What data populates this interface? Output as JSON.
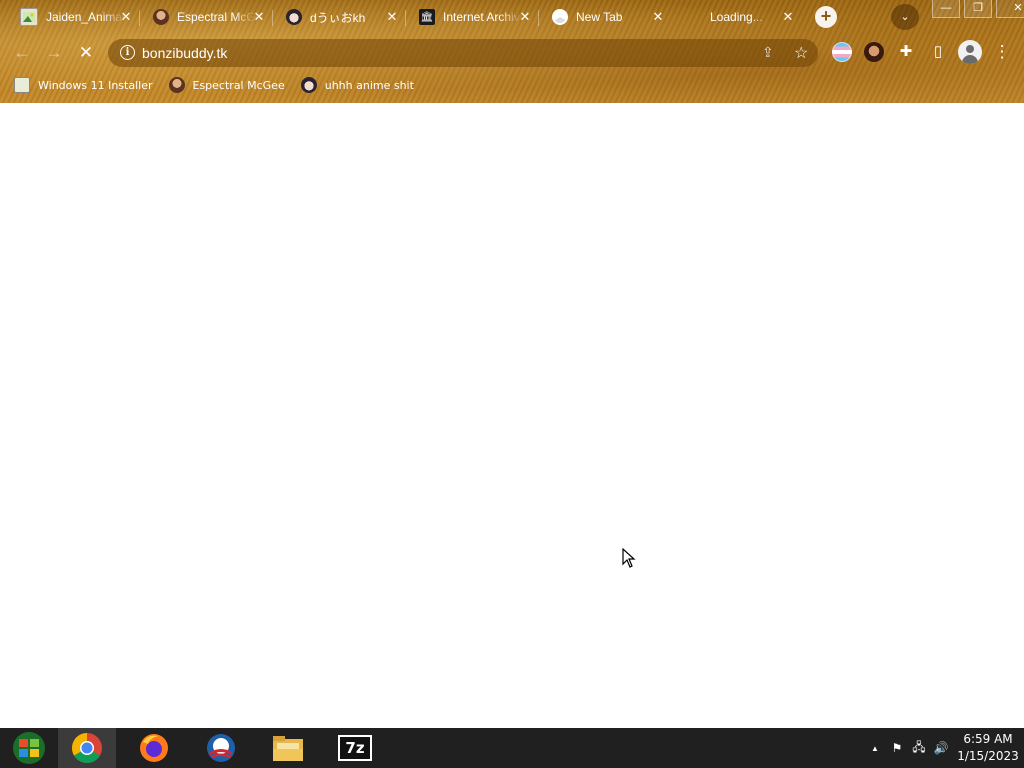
{
  "tabs": [
    {
      "title": "Jaiden_Animations",
      "favicon": "image-icon",
      "close": "✕"
    },
    {
      "title": "Espectral McGee",
      "favicon": "avatar-icon",
      "close": "✕"
    },
    {
      "title": "dうぃおkh",
      "favicon": "anime-avatar-icon",
      "close": "✕"
    },
    {
      "title": "Internet Archive",
      "favicon": "archive-icon",
      "close": "✕"
    },
    {
      "title": "New Tab",
      "favicon": "chrome-icon",
      "close": "✕"
    },
    {
      "title": "Loading...",
      "favicon": "loading-icon",
      "close": "✕"
    }
  ],
  "new_tab_label": "+",
  "tab_search_label": "⌄",
  "window": {
    "minimize": "—",
    "restore": "❐",
    "close": "✕"
  },
  "toolbar": {
    "back": "←",
    "forward": "→",
    "stop": "✕",
    "url": "bonzibuddy.tk",
    "info": "i",
    "share": "⇪",
    "bookmark_star": "☆",
    "extensions": "✚",
    "side_panel": "▯",
    "menu": "⋮"
  },
  "bookmarks": [
    {
      "label": "Windows 11 Installer",
      "icon": "image-icon"
    },
    {
      "label": "Espectral McGee",
      "icon": "avatar-icon"
    },
    {
      "label": "uhhh anime shit",
      "icon": "anime-avatar-icon"
    }
  ],
  "taskbar": {
    "apps": [
      "start-orb",
      "chrome",
      "firefox",
      "obama",
      "file-explorer",
      "7-zip"
    ],
    "seven_zip_label": "7z",
    "tray": {
      "chevron": "▲",
      "flag": "⚑",
      "network": "🖧",
      "volume": "🔊"
    },
    "time": "6:59 AM",
    "date": "1/15/2023"
  },
  "colors": {
    "theme_dark": "#9a6512",
    "theme_light": "#c4892a",
    "taskbar": "#202020"
  }
}
